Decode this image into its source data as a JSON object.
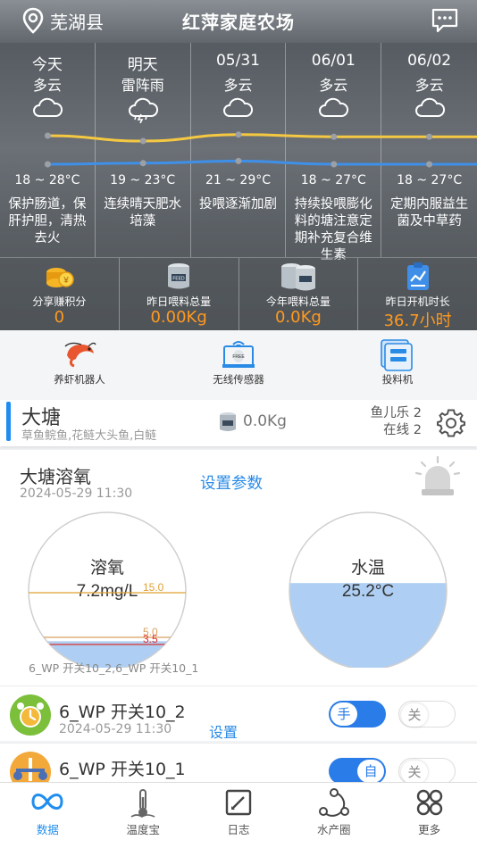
{
  "header": {
    "location": "芜湖县",
    "title": "红萍家庭农场"
  },
  "weather": [
    {
      "date": "今天",
      "condition": "多云",
      "icon": "cloud-icon",
      "temp": "18 ~ 28°C",
      "high": 28,
      "low": 18,
      "tip": "保护肠道，保肝护胆，清热去火"
    },
    {
      "date": "明天",
      "condition": "雷阵雨",
      "icon": "thunderstorm-icon",
      "temp": "19 ~ 23°C",
      "high": 23,
      "low": 19,
      "tip": "连续晴天肥水培藻"
    },
    {
      "date": "05/31",
      "condition": "多云",
      "icon": "cloud-icon",
      "temp": "21 ~ 29°C",
      "high": 29,
      "low": 21,
      "tip": "投喂逐渐加剧"
    },
    {
      "date": "06/01",
      "condition": "多云",
      "icon": "cloud-icon",
      "temp": "18 ~ 27°C",
      "high": 27,
      "low": 18,
      "tip": "持续投喂膨化料的塘注意定期补充复合维生素"
    },
    {
      "date": "06/02",
      "condition": "多云",
      "icon": "cloud-icon",
      "temp": "18 ~ 27°C",
      "high": 27,
      "low": 18,
      "tip": "定期内服益生菌及中草药"
    }
  ],
  "stats": [
    {
      "label": "分享赚积分",
      "value": "0",
      "icon": "coins-icon"
    },
    {
      "label": "昨日喂料总量",
      "value": "0.00Kg",
      "icon": "feed-bucket-icon"
    },
    {
      "label": "今年喂料总量",
      "value": "0.0Kg",
      "icon": "feed-buckets-icon"
    },
    {
      "label": "昨日开机时长",
      "value": "36.7小时",
      "icon": "clipboard-chart-icon"
    }
  ],
  "tools": [
    {
      "label": "养虾机器人",
      "icon": "shrimp-icon"
    },
    {
      "label": "无线传感器",
      "icon": "wireless-sensor-icon"
    },
    {
      "label": "投料机",
      "icon": "feeder-icon"
    }
  ],
  "pond": {
    "name": "大塘",
    "species": "草鱼鲩鱼,花鲢大头鱼,白鲢",
    "feed": "0.0Kg",
    "fish_app": "鱼儿乐 2",
    "online": "在线 2"
  },
  "oxygen_card": {
    "title": "大塘溶氧",
    "time": "2024-05-29 11:30",
    "settings_link": "设置参数",
    "caption": "6_WP 开关10_2,6_WP 开关10_1",
    "do_gauge": {
      "label": "溶氧",
      "value_text": "7.2mg/L",
      "value": 7.2,
      "max": 15.0,
      "thresholds": [
        "15.0",
        "5.0",
        "3.5"
      ],
      "fill_level": 0.18
    },
    "temp_gauge": {
      "label": "水温",
      "value_text": "25.2°C",
      "value": 25.2,
      "fill_level": 0.55
    },
    "colors": {
      "water": "#aecff3",
      "accent": "#2a8be6",
      "threshold_high": "#e0a030",
      "threshold_mid": "#d8a060",
      "threshold_low": "#e03030"
    }
  },
  "switches": [
    {
      "name": "6_WP 开关10_2",
      "time": "2024-05-29 11:30",
      "settings": "设置",
      "on_label": "手",
      "off_label": "关",
      "state": "手"
    },
    {
      "name": "6_WP 开关10_1",
      "time": "",
      "settings": "设置",
      "on_label": "自",
      "off_label": "关",
      "state": "自"
    }
  ],
  "tabs": [
    {
      "label": "数据",
      "icon": "data-infinity-icon",
      "active": true
    },
    {
      "label": "温度宝",
      "icon": "thermometer-icon",
      "active": false
    },
    {
      "label": "日志",
      "icon": "log-icon",
      "active": false
    },
    {
      "label": "水产圈",
      "icon": "community-icon",
      "active": false
    },
    {
      "label": "更多",
      "icon": "more-grid-icon",
      "active": false
    }
  ]
}
